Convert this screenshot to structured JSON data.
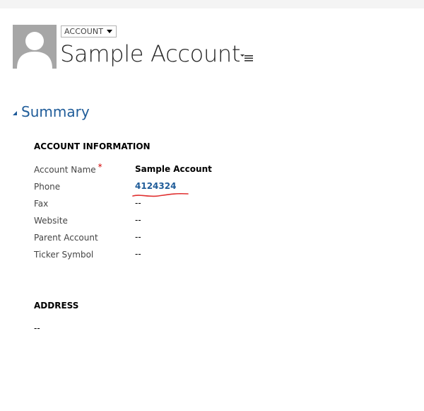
{
  "header": {
    "entity_selector_label": "ACCOUNT",
    "record_title": "Sample Account"
  },
  "summary": {
    "section_title": "Summary",
    "account_information": {
      "group_title": "ACCOUNT INFORMATION",
      "fields": [
        {
          "label": "Account Name",
          "value": "Sample Account",
          "required": true
        },
        {
          "label": "Phone",
          "value": "4124324"
        },
        {
          "label": "Fax",
          "value": "--"
        },
        {
          "label": "Website",
          "value": "--"
        },
        {
          "label": "Parent Account",
          "value": "--"
        },
        {
          "label": "Ticker Symbol",
          "value": "--"
        }
      ]
    },
    "address": {
      "group_title": "ADDRESS",
      "value": "--"
    }
  },
  "colors": {
    "accent": "#1f5c99",
    "required": "#d40000",
    "annotation": "#e03030",
    "avatar_bg": "#a6a6a6"
  },
  "icons": {
    "avatar": "person-silhouette-icon",
    "entity_dropdown": "caret-down-icon",
    "form_menu": "form-selector-menu-icon",
    "section_toggle": "collapse-triangle-icon"
  },
  "required_marker": "*"
}
